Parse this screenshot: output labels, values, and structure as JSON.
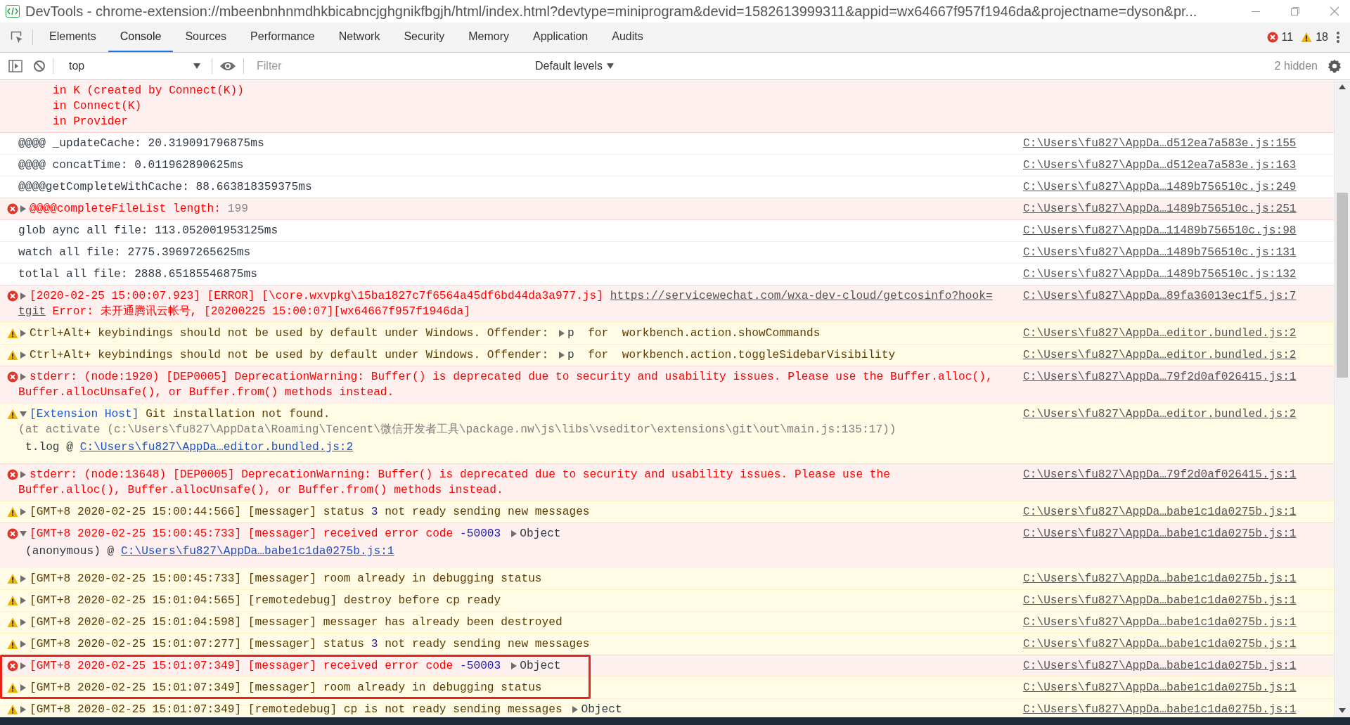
{
  "window": {
    "title": "DevTools - chrome-extension://mbeenbnhnmdhkbicabncjghgnikfbgjh/html/index.html?devtype=miniprogram&devid=1582613999311&appid=wx64667f957f1946da&projectname=dyson&pr..."
  },
  "tabs": [
    {
      "label": "Elements",
      "selected": false
    },
    {
      "label": "Console",
      "selected": true
    },
    {
      "label": "Sources",
      "selected": false
    },
    {
      "label": "Performance",
      "selected": false
    },
    {
      "label": "Network",
      "selected": false
    },
    {
      "label": "Security",
      "selected": false
    },
    {
      "label": "Memory",
      "selected": false
    },
    {
      "label": "Application",
      "selected": false
    },
    {
      "label": "Audits",
      "selected": false
    }
  ],
  "counts": {
    "errors": "11",
    "warnings": "18"
  },
  "toolbar": {
    "context": "top",
    "filter": {
      "placeholder": "Filter"
    },
    "levels": "Default levels",
    "hidden": "2 hidden"
  },
  "messages": [
    {
      "kind": "stack",
      "highlighted": false,
      "lines": [
        [
          {
            "kind": "text",
            "text": "in K (created by Connect(K))"
          }
        ],
        [
          {
            "kind": "text",
            "text": "in Connect(K)"
          }
        ],
        [
          {
            "kind": "text",
            "text": "in Provider"
          }
        ]
      ]
    },
    {
      "kind": "info",
      "highlighted": false,
      "lines": [
        [
          {
            "kind": "text",
            "text": "@@@@ _updateCache: 20.319091796875ms"
          }
        ]
      ],
      "source": "C:\\Users\\fu827\\AppDa…d512ea7a583e.js:155"
    },
    {
      "kind": "info",
      "highlighted": false,
      "lines": [
        [
          {
            "kind": "text",
            "text": "@@@@ concatTime: 0.011962890625ms"
          }
        ]
      ],
      "source": "C:\\Users\\fu827\\AppDa…d512ea7a583e.js:163"
    },
    {
      "kind": "info",
      "highlighted": false,
      "lines": [
        [
          {
            "kind": "text",
            "text": "@@@@getCompleteWithCache: 88.663818359375ms"
          }
        ]
      ],
      "source": "C:\\Users\\fu827\\AppDa…1489b756510c.js:249"
    },
    {
      "kind": "error",
      "highlighted": false,
      "expanded": false,
      "lines": [
        [
          {
            "kind": "text",
            "text": "@@@@completeFileList length: "
          },
          {
            "kind": "value",
            "text": "199"
          }
        ]
      ],
      "source": "C:\\Users\\fu827\\AppDa…1489b756510c.js:251"
    },
    {
      "kind": "info",
      "highlighted": false,
      "lines": [
        [
          {
            "kind": "text",
            "text": "glob aync all file: 113.052001953125ms"
          }
        ]
      ],
      "source": "C:\\Users\\fu827\\AppDa…11489b756510c.js:98"
    },
    {
      "kind": "info",
      "highlighted": false,
      "lines": [
        [
          {
            "kind": "text",
            "text": "watch all file: 2775.39697265625ms"
          }
        ]
      ],
      "source": "C:\\Users\\fu827\\AppDa…1489b756510c.js:131"
    },
    {
      "kind": "info",
      "highlighted": false,
      "lines": [
        [
          {
            "kind": "text",
            "text": "totlal all file: 2888.65185546875ms"
          }
        ]
      ],
      "source": "C:\\Users\\fu827\\AppDa…1489b756510c.js:132"
    },
    {
      "kind": "error",
      "highlighted": false,
      "expanded": false,
      "lines": [
        [
          {
            "kind": "text",
            "text": "[2020-02-25 15:00:07.923] [ERROR] [\\core.wxvpkg\\15ba1827c7f6564a45df6bd44da3a977.js] "
          },
          {
            "kind": "link",
            "text": "https://servicewechat.com/wxa-dev-cloud/getcosinfo?hook="
          }
        ],
        [
          {
            "kind": "link",
            "text": "tgit"
          },
          {
            "kind": "text",
            "text": " Error: 未开通腾讯云帐号, [20200225 15:00:07][wx64667f957f1946da]"
          }
        ]
      ],
      "source": "C:\\Users\\fu827\\AppDa…89fa36013ec1f5.js:7"
    },
    {
      "kind": "warning",
      "highlighted": false,
      "expanded": false,
      "lines": [
        [
          {
            "kind": "text",
            "text": "Ctrl+Alt+ keybindings should not be used by default under Windows. Offender: "
          },
          {
            "kind": "offender",
            "text": "p"
          },
          {
            "kind": "text",
            "text": "  for  workbench.action.showCommands"
          }
        ]
      ],
      "source": "C:\\Users\\fu827\\AppDa…editor.bundled.js:2"
    },
    {
      "kind": "warning",
      "highlighted": false,
      "expanded": false,
      "lines": [
        [
          {
            "kind": "text",
            "text": "Ctrl+Alt+ keybindings should not be used by default under Windows. Offender: "
          },
          {
            "kind": "offender",
            "text": "p"
          },
          {
            "kind": "text",
            "text": "  for  workbench.action.toggleSidebarVisibility"
          }
        ]
      ],
      "source": "C:\\Users\\fu827\\AppDa…editor.bundled.js:2"
    },
    {
      "kind": "error",
      "highlighted": false,
      "expanded": false,
      "lines": [
        [
          {
            "kind": "text",
            "text": "stderr: (node:1920) [DEP0005] DeprecationWarning: Buffer() is deprecated due to security and usability issues. Please use the Buffer.alloc(),"
          }
        ],
        [
          {
            "kind": "text",
            "text": "Buffer.allocUnsafe(), or Buffer.from() methods instead."
          }
        ]
      ],
      "source": "C:\\Users\\fu827\\AppDa…79f2d0af026415.js:1"
    },
    {
      "kind": "warning",
      "highlighted": false,
      "expanded": true,
      "lines": [
        [
          {
            "kind": "tag",
            "text": "[Extension Host]"
          },
          {
            "kind": "text",
            "text": " Git installation not found."
          }
        ],
        [
          {
            "kind": "dim",
            "text": "(at activate (c:\\Users\\fu827\\AppData\\Roaming\\Tencent\\微信开发者工具\\package.nw\\js\\libs\\vseditor\\extensions\\git\\out\\main.js:135:17))"
          }
        ]
      ],
      "trace": [
        {
          "kind": "plain",
          "text": "t.log @ "
        },
        {
          "kind": "trace-link",
          "text": "C:\\Users\\fu827\\AppDa…editor.bundled.js:2"
        }
      ],
      "source": "C:\\Users\\fu827\\AppDa…editor.bundled.js:2"
    },
    {
      "kind": "error",
      "highlighted": false,
      "expanded": false,
      "lines": [
        [
          {
            "kind": "text",
            "text": "stderr: (node:13648) [DEP0005] DeprecationWarning: Buffer() is deprecated due to security and usability issues. Please use the"
          }
        ],
        [
          {
            "kind": "text",
            "text": "Buffer.alloc(), Buffer.allocUnsafe(), or Buffer.from() methods instead."
          }
        ]
      ],
      "source": "C:\\Users\\fu827\\AppDa…79f2d0af026415.js:1"
    },
    {
      "kind": "warning",
      "highlighted": false,
      "expanded": false,
      "lines": [
        [
          {
            "kind": "text",
            "text": "[GMT+8 2020-02-25 15:00:44:566] [messager] status "
          },
          {
            "kind": "number",
            "text": "3"
          },
          {
            "kind": "text",
            "text": " not ready sending new messages"
          }
        ]
      ],
      "source": "C:\\Users\\fu827\\AppDa…babe1c1da0275b.js:1"
    },
    {
      "kind": "error",
      "highlighted": false,
      "expanded": true,
      "lines": [
        [
          {
            "kind": "text",
            "text": "[GMT+8 2020-02-25 15:00:45:733] [messager] received error code "
          },
          {
            "kind": "number",
            "text": "-50003"
          },
          {
            "kind": "object",
            "text": "Object"
          }
        ]
      ],
      "trace": [
        {
          "kind": "plain",
          "text": "(anonymous) @ "
        },
        {
          "kind": "trace-link",
          "text": "C:\\Users\\fu827\\AppDa…babe1c1da0275b.js:1"
        }
      ],
      "source": "C:\\Users\\fu827\\AppDa…babe1c1da0275b.js:1"
    },
    {
      "kind": "warning",
      "highlighted": false,
      "expanded": false,
      "lines": [
        [
          {
            "kind": "text",
            "text": "[GMT+8 2020-02-25 15:00:45:733] [messager] room already in debugging status"
          }
        ]
      ],
      "source": "C:\\Users\\fu827\\AppDa…babe1c1da0275b.js:1"
    },
    {
      "kind": "warning",
      "highlighted": false,
      "expanded": false,
      "lines": [
        [
          {
            "kind": "text",
            "text": "[GMT+8 2020-02-25 15:01:04:565] [remotedebug] destroy before cp ready"
          }
        ]
      ],
      "source": "C:\\Users\\fu827\\AppDa…babe1c1da0275b.js:1"
    },
    {
      "kind": "warning",
      "highlighted": false,
      "expanded": false,
      "lines": [
        [
          {
            "kind": "text",
            "text": "[GMT+8 2020-02-25 15:01:04:598] [messager] messager has already been destroyed"
          }
        ]
      ],
      "source": "C:\\Users\\fu827\\AppDa…babe1c1da0275b.js:1"
    },
    {
      "kind": "warning",
      "highlighted": false,
      "expanded": false,
      "lines": [
        [
          {
            "kind": "text",
            "text": "[GMT+8 2020-02-25 15:01:07:277] [messager] status "
          },
          {
            "kind": "number",
            "text": "3"
          },
          {
            "kind": "text",
            "text": " not ready sending new messages"
          }
        ]
      ],
      "source": "C:\\Users\\fu827\\AppDa…babe1c1da0275b.js:1"
    },
    {
      "kind": "error",
      "highlighted": true,
      "expanded": false,
      "lines": [
        [
          {
            "kind": "text",
            "text": "[GMT+8 2020-02-25 15:01:07:349] [messager] received error code "
          },
          {
            "kind": "number",
            "text": "-50003"
          },
          {
            "kind": "object",
            "text": "Object"
          }
        ]
      ],
      "source": "C:\\Users\\fu827\\AppDa…babe1c1da0275b.js:1"
    },
    {
      "kind": "warning",
      "highlighted": true,
      "expanded": false,
      "lines": [
        [
          {
            "kind": "text",
            "text": "[GMT+8 2020-02-25 15:01:07:349] [messager] room already in debugging status"
          }
        ]
      ],
      "source": "C:\\Users\\fu827\\AppDa…babe1c1da0275b.js:1"
    },
    {
      "kind": "warning",
      "highlighted": false,
      "expanded": false,
      "lines": [
        [
          {
            "kind": "text",
            "text": "[GMT+8 2020-02-25 15:01:07:349] [remotedebug] cp is not ready sending messages "
          },
          {
            "kind": "object",
            "text": "Object"
          }
        ]
      ],
      "source": "C:\\Users\\fu827\\AppDa…babe1c1da0275b.js:1"
    }
  ]
}
